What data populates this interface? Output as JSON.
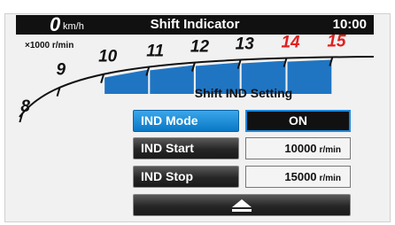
{
  "status_bar": {
    "speed": "0",
    "speed_unit": "km/h",
    "title": "Shift Indicator",
    "clock": "10:00"
  },
  "tachometer": {
    "unit_label": "×1000 r/min",
    "tick_labels": [
      {
        "value": "8",
        "color": "#111111"
      },
      {
        "value": "9",
        "color": "#111111"
      },
      {
        "value": "10",
        "color": "#111111"
      },
      {
        "value": "11",
        "color": "#111111"
      },
      {
        "value": "12",
        "color": "#111111"
      },
      {
        "value": "13",
        "color": "#111111"
      },
      {
        "value": "14",
        "color": "#e02020"
      },
      {
        "value": "15",
        "color": "#e02020"
      }
    ],
    "shift_band": {
      "from_rpm": 10000,
      "to_rpm": 15000,
      "color": "#1f75c2"
    }
  },
  "settings": {
    "title": "Shift IND Setting",
    "rows": [
      {
        "label": "IND Mode",
        "value": "ON",
        "unit": "",
        "selected": true
      },
      {
        "label": "IND Start",
        "value": "10000",
        "unit": "r/min",
        "selected": false
      },
      {
        "label": "IND Stop",
        "value": "15000",
        "unit": "r/min",
        "selected": false
      }
    ],
    "back_icon": "eject-icon"
  },
  "colors": {
    "accent_blue": "#1c8ae0",
    "redline": "#e02020",
    "background": "#f1f1f1"
  }
}
